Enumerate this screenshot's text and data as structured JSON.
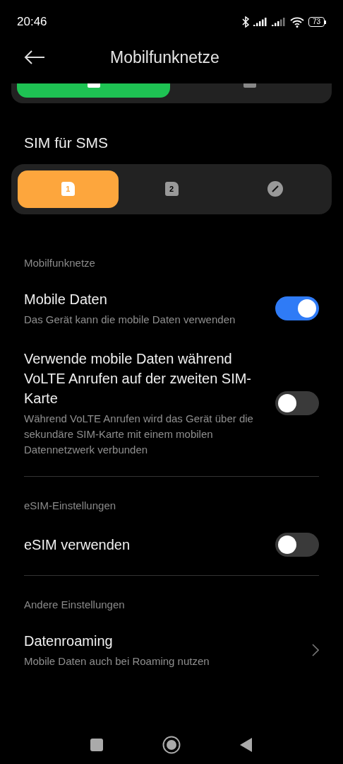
{
  "status_bar": {
    "time": "20:46",
    "battery": "73"
  },
  "header": {
    "title": "Mobilfunknetze"
  },
  "data_sim_selector": {
    "segments": [
      {
        "selected": true
      },
      {
        "selected": false
      }
    ]
  },
  "sms_sim": {
    "title": "SIM für SMS",
    "segments": [
      {
        "kind": "sim",
        "label": "1",
        "selected": true
      },
      {
        "kind": "sim",
        "label": "2",
        "selected": false
      },
      {
        "kind": "edit",
        "selected": false
      }
    ]
  },
  "sections": [
    {
      "title": "Mobilfunknetze",
      "items": [
        {
          "kind": "toggle",
          "title": "Mobile Daten",
          "subtitle": "Das Gerät kann die mobile Daten verwenden",
          "on": true
        },
        {
          "kind": "toggle",
          "title": "Verwende mobile Daten während VoLTE Anrufen auf der zweiten SIM-Karte",
          "subtitle": "Während VoLTE Anrufen wird das Gerät über die sekundäre SIM-Karte mit einem mobilen Datennetzwerk verbunden",
          "on": false
        }
      ]
    },
    {
      "title": "eSIM-Einstellungen",
      "items": [
        {
          "kind": "toggle",
          "title": "eSIM verwenden",
          "on": false
        }
      ]
    },
    {
      "title": "Andere Einstellungen",
      "items": [
        {
          "kind": "link",
          "title": "Datenroaming",
          "subtitle": "Mobile Daten auch bei Roaming nutzen"
        }
      ]
    }
  ]
}
